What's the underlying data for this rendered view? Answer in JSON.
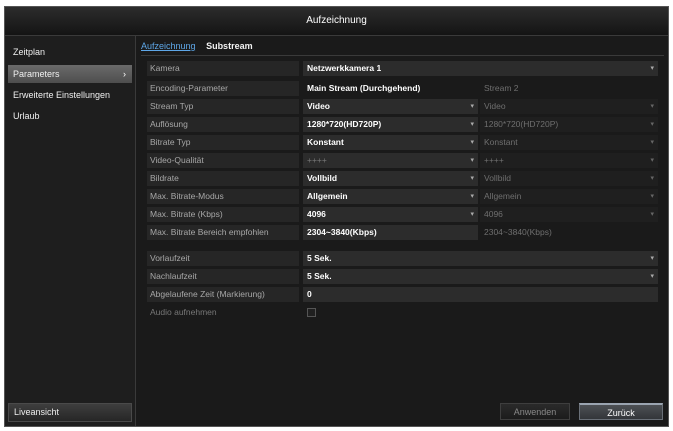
{
  "window": {
    "title": "Aufzeichnung"
  },
  "sidebar": {
    "items": [
      {
        "label": "Zeitplan"
      },
      {
        "label": "Parameters",
        "chevron": "›"
      },
      {
        "label": "Erweiterte Einstellungen"
      },
      {
        "label": "Urlaub"
      }
    ],
    "live_view": "Liveansicht"
  },
  "tabs": [
    {
      "label": "Aufzeichnung"
    },
    {
      "label": "Substream"
    }
  ],
  "form": {
    "camera": {
      "label": "Kamera",
      "value": "Netzwerkkamera 1"
    },
    "encoding": {
      "label": "Encoding-Parameter",
      "main": "Main Stream (Durchgehend)",
      "sub": "Stream 2"
    },
    "stream_type": {
      "label": "Stream Typ",
      "main": "Video",
      "sub": "Video"
    },
    "resolution": {
      "label": "Auflösung",
      "main": "1280*720(HD720P)",
      "sub": "1280*720(HD720P)"
    },
    "bitrate_type": {
      "label": "Bitrate Typ",
      "main": "Konstant",
      "sub": "Konstant"
    },
    "video_quality": {
      "label": "Video-Qualität",
      "main": "++++",
      "sub": "++++"
    },
    "framerate": {
      "label": "Bildrate",
      "main": "Vollbild",
      "sub": "Vollbild"
    },
    "max_bitrate_mode": {
      "label": "Max. Bitrate-Modus",
      "main": "Allgemein",
      "sub": "Allgemein"
    },
    "max_bitrate": {
      "label": "Max. Bitrate (Kbps)",
      "main": "4096",
      "sub": "4096"
    },
    "max_bitrate_range": {
      "label": "Max. Bitrate Bereich empfohlen",
      "main": "2304~3840(Kbps)",
      "sub": "2304~3840(Kbps)"
    },
    "pre_record": {
      "label": "Vorlaufzeit",
      "value": "5 Sek."
    },
    "post_record": {
      "label": "Nachlaufzeit",
      "value": "5 Sek."
    },
    "expired_time": {
      "label": "Abgelaufene Zeit (Markierung)",
      "value": "0"
    },
    "audio": {
      "label": "Audio aufnehmen",
      "checked": false
    }
  },
  "buttons": {
    "apply": "Anwenden",
    "back": "Zurück"
  },
  "icons": {
    "dropdown": "▾"
  }
}
